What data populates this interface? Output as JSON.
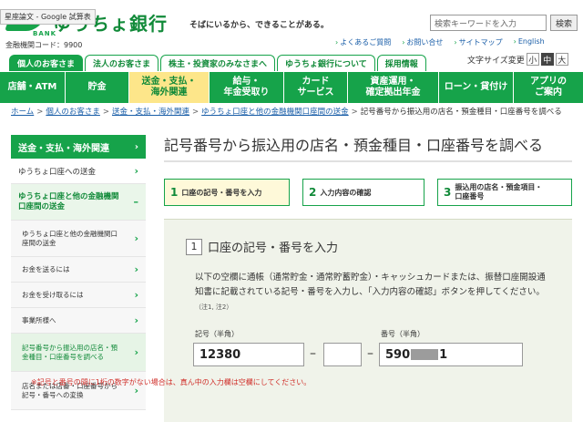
{
  "header": {
    "overlay_badge": "星座論文 - Google 試算表",
    "logo_text": "ゆうちょ銀行",
    "logo_sub": "BANK",
    "tagline": "そばにいるから、できることがある。",
    "bank_code": "金融機関コード：9900",
    "search_placeholder": "検索キーワードを入力",
    "search_button": "検索",
    "util_links": [
      "よくあるご質問",
      "お問い合せ",
      "サイトマップ",
      "English"
    ],
    "font_size_label": "文字サイズ変更",
    "font_sizes": [
      "小",
      "中",
      "大"
    ]
  },
  "tabs": [
    "個人のお客さま",
    "法人のお客さま",
    "株主・投資家のみなさまへ",
    "ゆうちょ銀行について",
    "採用情報"
  ],
  "gnav": [
    {
      "label": "店舗・ATM"
    },
    {
      "label": "貯金"
    },
    {
      "label": "送金・支払・\n海外関連"
    },
    {
      "label": "給与・\n年金受取り"
    },
    {
      "label": "カード\nサービス"
    },
    {
      "label": "資産運用・\n確定拠出年金"
    },
    {
      "label": "ローン・貸付け"
    },
    {
      "label": "アプリの\nご案内"
    }
  ],
  "breadcrumb": {
    "items": [
      "ホーム",
      "個人のお客さま",
      "送金・支払・海外関連",
      "ゆうちょ口座と他の金融機関口座間の送金"
    ],
    "current": "記号番号から振込用の店名・預金種目・口座番号を調べる"
  },
  "sidebar": {
    "head": "送金・支払・海外関連",
    "items": [
      {
        "label": "ゆうちょ口座への送金"
      },
      {
        "label": "ゆうちょ口座と他の金融機関口座間の送金",
        "mark": "–"
      },
      {
        "label": "ゆうちょ口座と他の金融機関口座間の送金"
      },
      {
        "label": "お金を送るには"
      },
      {
        "label": "お金を受け取るには"
      },
      {
        "label": "事業所様へ"
      },
      {
        "label": "記号番号から振込用の店名・預金種目・口座番号を調べる"
      },
      {
        "label": "店名または店番・口座番号から記号・番号への変換"
      }
    ]
  },
  "main": {
    "title": "記号番号から振込用の店名・預金種目・口座番号を調べる",
    "steps": [
      {
        "num": "1",
        "label": "口座の記号・番号を入力"
      },
      {
        "num": "2",
        "label": "入力内容の確認"
      },
      {
        "num": "3",
        "label": "振込用の店名・預金項目・\n口座番号"
      }
    ],
    "panel": {
      "num": "1",
      "title": "口座の記号・番号を入力",
      "desc": "以下の空欄に通帳（通常貯金・通常貯蓄貯金）・キャッシュカードまたは、振替口座開設通知書に記載されている記号・番号を入力し、「入力内容の確認」ボタンを押してください。",
      "desc_note": "（注1, 注2）",
      "kigo_label": "記号（半角）",
      "kigo_value": "12380",
      "bango_label": "番号（半角）",
      "bango_prefix": "590",
      "bango_suffix": "1",
      "dash": "–",
      "warning": "※記号と番号の間に1桁の数字がない場合は、真ん中の入力欄は空欄にしてください。"
    }
  },
  "colors": {
    "brand_green": "#16a34a",
    "active_nav": "#fde68a",
    "warning": "#d0302b"
  }
}
